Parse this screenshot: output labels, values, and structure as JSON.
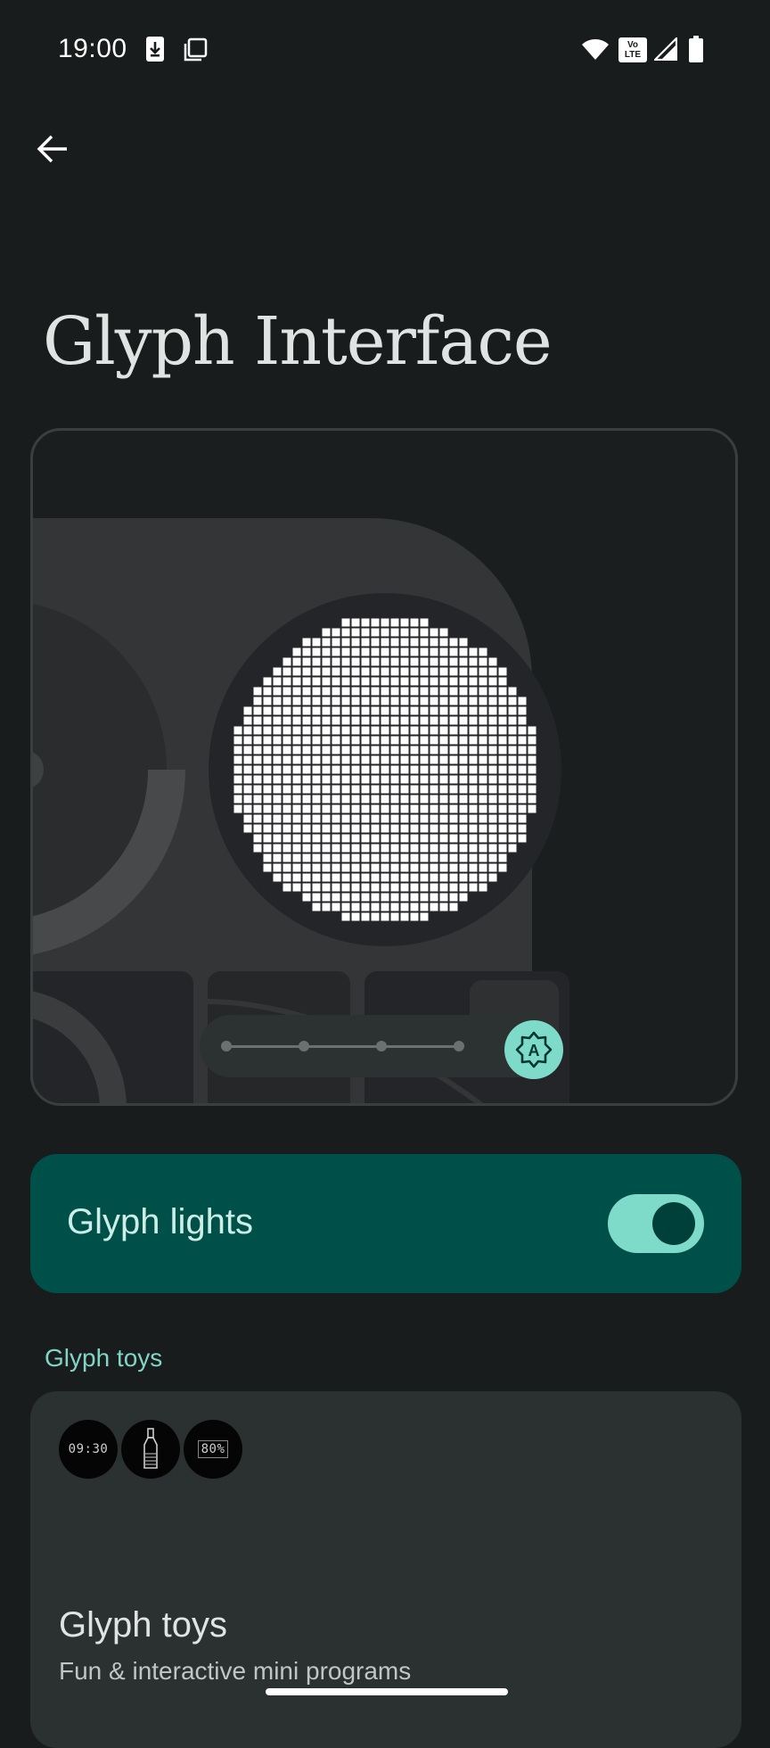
{
  "status_bar": {
    "time": "19:00",
    "icons": [
      "download-icon",
      "screenshot-icon",
      "wifi-icon",
      "volte-icon",
      "signal-icon",
      "battery-icon"
    ],
    "volte_label_top": "Vo",
    "volte_label_bottom": "LTE"
  },
  "header": {
    "back_icon": "arrow-left-icon",
    "title": "Glyph Interface"
  },
  "preview": {
    "slider_stops": 4,
    "auto_brightness_icon": "auto-brightness-icon",
    "auto_label": "A"
  },
  "glyph_lights": {
    "label": "Glyph lights",
    "enabled": true
  },
  "glyph_toys_section": {
    "header": "Glyph toys"
  },
  "glyph_toys_card": {
    "toy_clock_text": "09:30",
    "toy_battery_text": "80%",
    "toy_bottle_icon": "bottle-icon",
    "title": "Glyph toys",
    "subtitle": "Fun & interactive mini programs"
  },
  "colors": {
    "background": "#191c1c",
    "accent": "#7fdbc9",
    "glyph_lights_bg": "#00504a",
    "card_bg": "#2a3130"
  }
}
